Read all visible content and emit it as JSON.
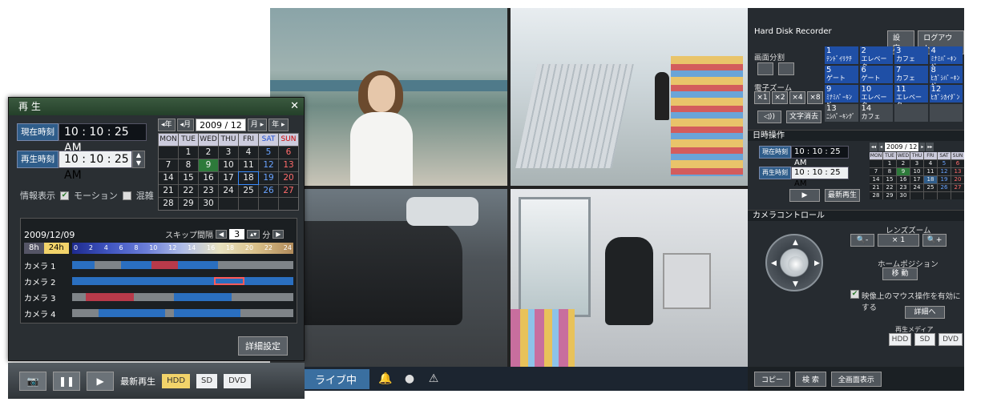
{
  "playback": {
    "title": "再 生",
    "current_time_label": "現在時刻",
    "current_time": "10 : 10 : 25 AM",
    "play_time_label": "再生時刻",
    "play_time": "10 : 10 : 25 AM",
    "info_label": "情報表示",
    "motion_label": "モーション",
    "congestion_label": "混雑",
    "calendar": {
      "year_prev": "◂年",
      "month_prev": "◂月",
      "month": "2009 / 12",
      "month_next": "月 ▸",
      "year_next": "年 ▸",
      "weekdays": [
        "MON",
        "TUE",
        "WED",
        "THU",
        "FRI",
        "SAT",
        "SUN"
      ],
      "days": [
        "",
        "1",
        "2",
        "3",
        "4",
        "5",
        "6",
        "7",
        "8",
        "9",
        "10",
        "11",
        "12",
        "13",
        "14",
        "15",
        "16",
        "17",
        "18",
        "19",
        "20",
        "21",
        "22",
        "23",
        "24",
        "25",
        "26",
        "27",
        "28",
        "29",
        "30",
        "",
        "",
        "",
        ""
      ]
    },
    "timeline": {
      "date": "2009/12/09",
      "skip_label": "スキップ間隔",
      "skip_value": "3",
      "skip_unit": "分",
      "zoom_8h": "8h",
      "zoom_24h": "24h",
      "hours": [
        "0",
        "2",
        "4",
        "6",
        "8",
        "10",
        "12",
        "14",
        "16",
        "18",
        "20",
        "22",
        "24"
      ],
      "cameras": [
        "カメラ 1",
        "カメラ 2",
        "カメラ 3",
        "カメラ 4"
      ]
    },
    "detail_button": "詳細設定",
    "bottom": {
      "latest_label": "最新再生",
      "media_label": "再生メディア",
      "media": [
        "HDD",
        "SD",
        "DVD"
      ]
    }
  },
  "live": {
    "status": "ライブ中"
  },
  "recorder": {
    "title": "Hard Disk Recorder",
    "settings_button": "設 定",
    "logout_button": "ログアウト",
    "split_label": "画面分割",
    "zoom_label": "電子ズーム",
    "zoom_buttons": [
      "×1",
      "×2",
      "×4",
      "×8"
    ],
    "audio_button": "◁))",
    "clear_text_button": "文字消去",
    "cameras": [
      {
        "num": "1",
        "name": "ﾃﾝﾄﾞｲﾘｸﾁ"
      },
      {
        "num": "2",
        "name": "エレベーター"
      },
      {
        "num": "3",
        "name": "カフェ"
      },
      {
        "num": "4",
        "name": "ﾐﾅﾐﾊﾟｰｷﾝｸﾞ"
      },
      {
        "num": "5",
        "name": "ゲート"
      },
      {
        "num": "6",
        "name": "ゲート"
      },
      {
        "num": "7",
        "name": "カフェ"
      },
      {
        "num": "8",
        "name": "ﾋｶﾞｼﾊﾟｰｷﾝｸﾞ"
      },
      {
        "num": "9",
        "name": "ﾐﾅﾐﾊﾟｰｷﾝｸﾞ"
      },
      {
        "num": "10",
        "name": "エレベーター"
      },
      {
        "num": "11",
        "name": "エレベーター"
      },
      {
        "num": "12",
        "name": "ﾋｶﾞｼｶｲﾀﾞﾝ"
      },
      {
        "num": "13",
        "name": "ﾆｼﾊﾟｰｷﾝｸﾞ"
      },
      {
        "num": "14",
        "name": "カフェ"
      }
    ],
    "datetime_section": "日時操作",
    "current_time_label": "現在時刻",
    "current_time": "10 : 10 : 25 AM",
    "play_time_label": "再生時刻",
    "play_time": "10 : 10 : 25 AM",
    "play_button": "▶",
    "latest_button": "最新再生",
    "mini_calendar": {
      "month": "2009 / 12",
      "weekdays": [
        "MON",
        "TUE",
        "WED",
        "THU",
        "FRI",
        "SAT",
        "SUN"
      ],
      "days": [
        "",
        "1",
        "2",
        "3",
        "4",
        "5",
        "6",
        "7",
        "8",
        "9",
        "10",
        "11",
        "12",
        "13",
        "14",
        "15",
        "16",
        "17",
        "18",
        "19",
        "20",
        "21",
        "22",
        "23",
        "24",
        "25",
        "26",
        "27",
        "28",
        "29",
        "30",
        "",
        "",
        "",
        ""
      ]
    },
    "camera_control_section": "カメラコントロール",
    "lens_zoom_label": "レンズズーム",
    "zoom_out": "🔍-",
    "zoom_value": "× 1",
    "zoom_in": "🔍+",
    "home_position_label": "ホームポジション",
    "move_button": "移 動",
    "mouse_control_label": "映像上のマウス操作を有効にする",
    "detail_button": "詳細へ",
    "media_label": "再生メディア",
    "media": [
      "HDD",
      "SD",
      "DVD"
    ],
    "copy_button": "コピー",
    "search_button": "検 索",
    "fullscreen_button": "全画面表示"
  }
}
